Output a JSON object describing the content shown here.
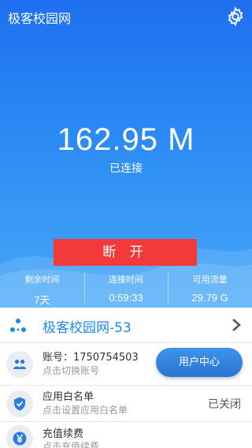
{
  "header": {
    "app_title": "极客校园网",
    "settings_icon": "gear-icon"
  },
  "connection": {
    "traffic": "162.95 M",
    "status": "已连接",
    "disconnect_label": "断 开",
    "button_color": "#f23a3a"
  },
  "stats": [
    {
      "label": "剩余时间",
      "value": "7天"
    },
    {
      "label": "连接时间",
      "value": "0:59:33"
    },
    {
      "label": "可用流量",
      "value": "29.79 G"
    }
  ],
  "network": {
    "name": "极客校园网-53",
    "icon": "network-nodes-icon"
  },
  "account": {
    "label": "账号：1750754503",
    "hint": "点击切换账号",
    "user_center_label": "用户中心",
    "icon": "users-icon"
  },
  "whitelist": {
    "title": "应用白名单",
    "hint": "点击设置应用白名单",
    "state": "已关闭",
    "icon": "shield-check-icon"
  },
  "recharge": {
    "title": "充值续费",
    "hint": "点击充值续费",
    "icon": "yen-icon"
  },
  "colors": {
    "accent": "#1e88e5",
    "hero_top": "#1f6ff0",
    "hero_bottom": "#46a8f8"
  }
}
